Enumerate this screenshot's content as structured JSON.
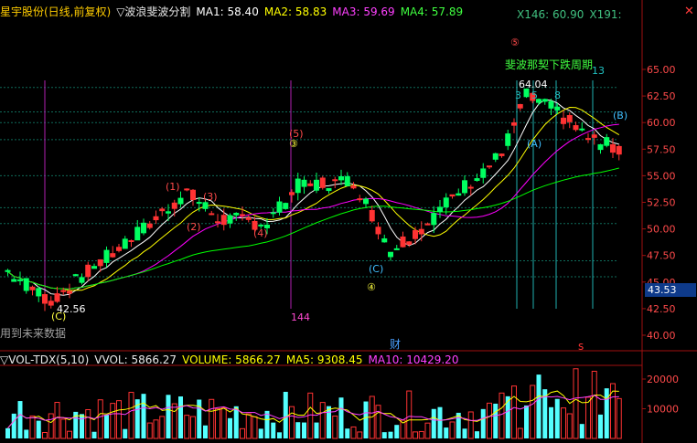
{
  "kline_header": {
    "stock_name": "星宇股份(日线,前复权)",
    "indicator": "▽波浪斐波分割",
    "ma1": "MA1: 58.40",
    "ma2": "MA2: 58.83",
    "ma3": "MA3: 59.69",
    "ma4": "MA4: 57.89",
    "x_left": "X146: 60.90",
    "x_right": "X191:"
  },
  "vol_header": {
    "indicator": "▽VOL-TDX(5,10)",
    "vvol": "VVOL: 5866.27",
    "volume": "VOLUME: 5866.27",
    "ma5": "MA5: 9308.45",
    "ma10": "MA10: 10429.20"
  },
  "price_axis": [
    "65.00",
    "62.50",
    "60.00",
    "57.50",
    "55.00",
    "52.50",
    "50.00",
    "47.50",
    "45.00",
    "42.50",
    "40.00"
  ],
  "volume_axis": [
    "20000",
    "10000"
  ],
  "current_price": "43.53",
  "annotations": {
    "low_price": "42.56",
    "high_price": "64.04",
    "note_top": "斐波那契下跌周期",
    "count_144": "144",
    "count_13": "13",
    "count_8": "8",
    "count_5": "5",
    "count_3": "3",
    "bottom_text": "用到未来数据",
    "finance_marker": "财",
    "s_marker": "s",
    "wave_labels": [
      "(1)",
      "(2)",
      "(3)",
      "(4)",
      "(5)",
      "③",
      "④",
      "⑤",
      "(A)",
      "(B)",
      "(C)",
      "(C)"
    ]
  },
  "colors": {
    "up": "#ff3333",
    "down": "#00ff60",
    "ma1": "#ffffff",
    "ma2": "#ffff00",
    "ma3": "#ff00ff",
    "ma4": "#00ff00",
    "vol_up": "#ff3333",
    "vol_down": "#54ffff",
    "grid": "#7a1010"
  }
}
